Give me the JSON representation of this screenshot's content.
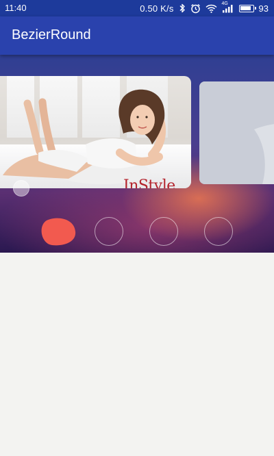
{
  "status_bar": {
    "time": "11:40",
    "network_speed": "0.50 K/s",
    "signal_type": "4G",
    "battery_level": "93",
    "icons": [
      "bluetooth-icon",
      "alarm-icon",
      "wifi-icon",
      "cellular-signal-icon",
      "battery-icon"
    ]
  },
  "app_bar": {
    "title": "BezierRound"
  },
  "banner": {
    "slides": [
      {
        "brand_text": "InStyle"
      },
      {
        "brand_text": ""
      }
    ]
  },
  "indicator": {
    "count": 4,
    "active_index": 0,
    "active_color": "#f25a4f",
    "inactive_color": "#ffffff"
  },
  "colors": {
    "status_bar": "#1d3a9b",
    "app_bar": "#2a42ad",
    "background": "#f3f3f1"
  }
}
